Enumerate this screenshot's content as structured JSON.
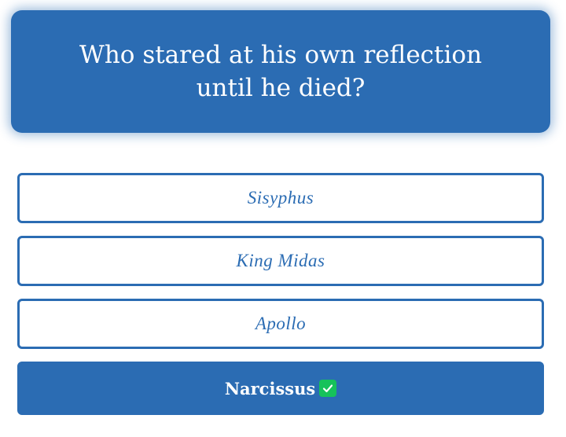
{
  "question": {
    "text": "Who stared at his own reflection until he died?"
  },
  "answers": [
    {
      "label": "Sisyphus",
      "state": "default"
    },
    {
      "label": "King Midas",
      "state": "default"
    },
    {
      "label": "Apollo",
      "state": "default"
    },
    {
      "label": "Narcissus",
      "state": "correct",
      "icon": "check-mark-icon"
    }
  ],
  "colors": {
    "accent": "#2b6cb3",
    "correct_icon_bg": "#16c25a",
    "background": "#ffffff"
  }
}
